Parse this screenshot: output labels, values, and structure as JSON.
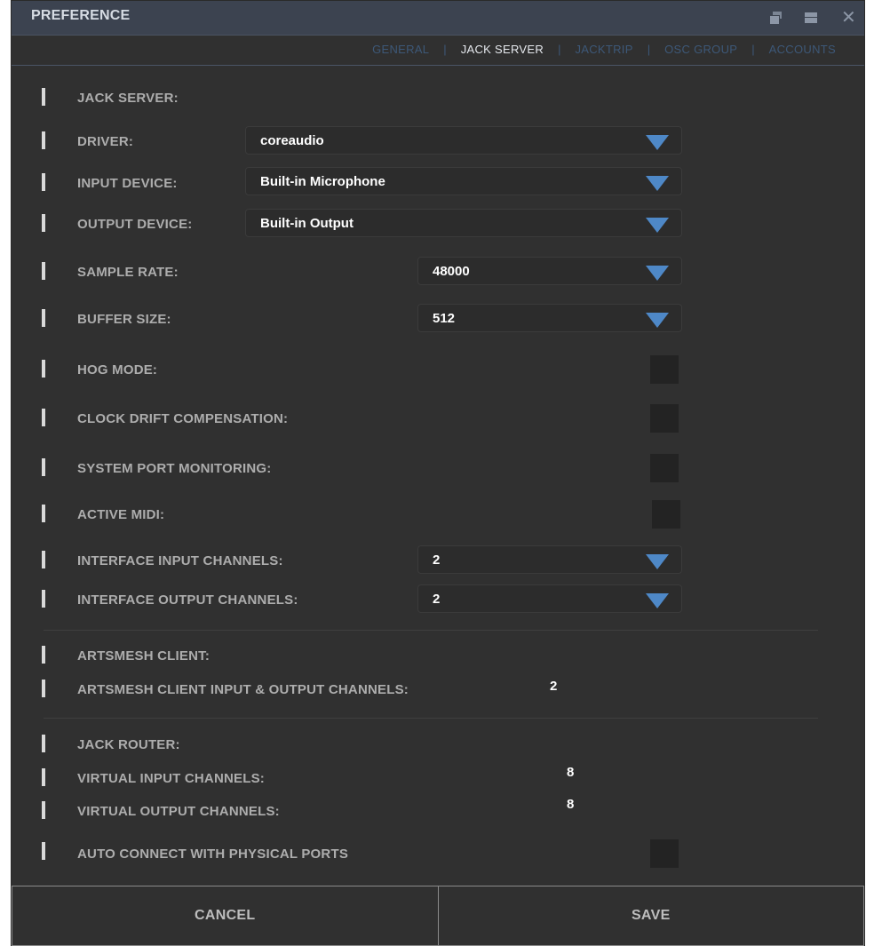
{
  "window": {
    "title": "PREFERENCE",
    "controls": [
      "restore-icon",
      "maximize-icon",
      "close-icon"
    ],
    "close_glyph": "✕"
  },
  "tabs": [
    {
      "label": "GENERAL",
      "active": false
    },
    {
      "label": "JACK SERVER",
      "active": true
    },
    {
      "label": "JACKTRIP",
      "active": false
    },
    {
      "label": "OSC GROUP",
      "active": false
    },
    {
      "label": "ACCOUNTS",
      "active": false
    }
  ],
  "tab_separator": "|",
  "jack_server": {
    "heading": "JACK SERVER:",
    "driver": {
      "label": "DRIVER:",
      "value": "coreaudio"
    },
    "input_device": {
      "label": "INPUT DEVICE:",
      "value": "Built-in Microphone"
    },
    "output_device": {
      "label": "OUTPUT DEVICE:",
      "value": "Built-in Output"
    },
    "sample_rate": {
      "label": "SAMPLE RATE:",
      "value": "48000"
    },
    "buffer_size": {
      "label": "BUFFER SIZE:",
      "value": "512"
    },
    "hog_mode": {
      "label": "HOG MODE:",
      "checked": false
    },
    "clock_drift": {
      "label": "CLOCK DRIFT COMPENSATION:",
      "checked": false
    },
    "port_monitoring": {
      "label": "SYSTEM PORT MONITORING:",
      "checked": false
    },
    "active_midi": {
      "label": "ACTIVE MIDI:",
      "checked": false
    },
    "input_channels": {
      "label": "INTERFACE INPUT CHANNELS:",
      "value": "2"
    },
    "output_channels": {
      "label": "INTERFACE OUTPUT CHANNELS:",
      "value": "2"
    }
  },
  "artsmesh_client": {
    "heading": "ARTSMESH CLIENT:",
    "io_channels": {
      "label": "ARTSMESH CLIENT INPUT & OUTPUT CHANNELS:",
      "value": "2"
    }
  },
  "jack_router": {
    "heading": "JACK ROUTER:",
    "virtual_input": {
      "label": "VIRTUAL INPUT CHANNELS:",
      "value": "8"
    },
    "virtual_output": {
      "label": "VIRTUAL OUTPUT CHANNELS:",
      "value": "8"
    },
    "auto_connect": {
      "label": "AUTO CONNECT WITH PHYSICAL PORTS",
      "checked": false
    }
  },
  "footer": {
    "cancel": "CANCEL",
    "save": "SAVE"
  },
  "colors": {
    "background": "#303030",
    "titlebar": "#3c4350",
    "tab_inactive": "#3d5878",
    "tab_active": "#e6e9ee",
    "dropdown_arrow": "#4e88c7",
    "label": "#adadad"
  }
}
